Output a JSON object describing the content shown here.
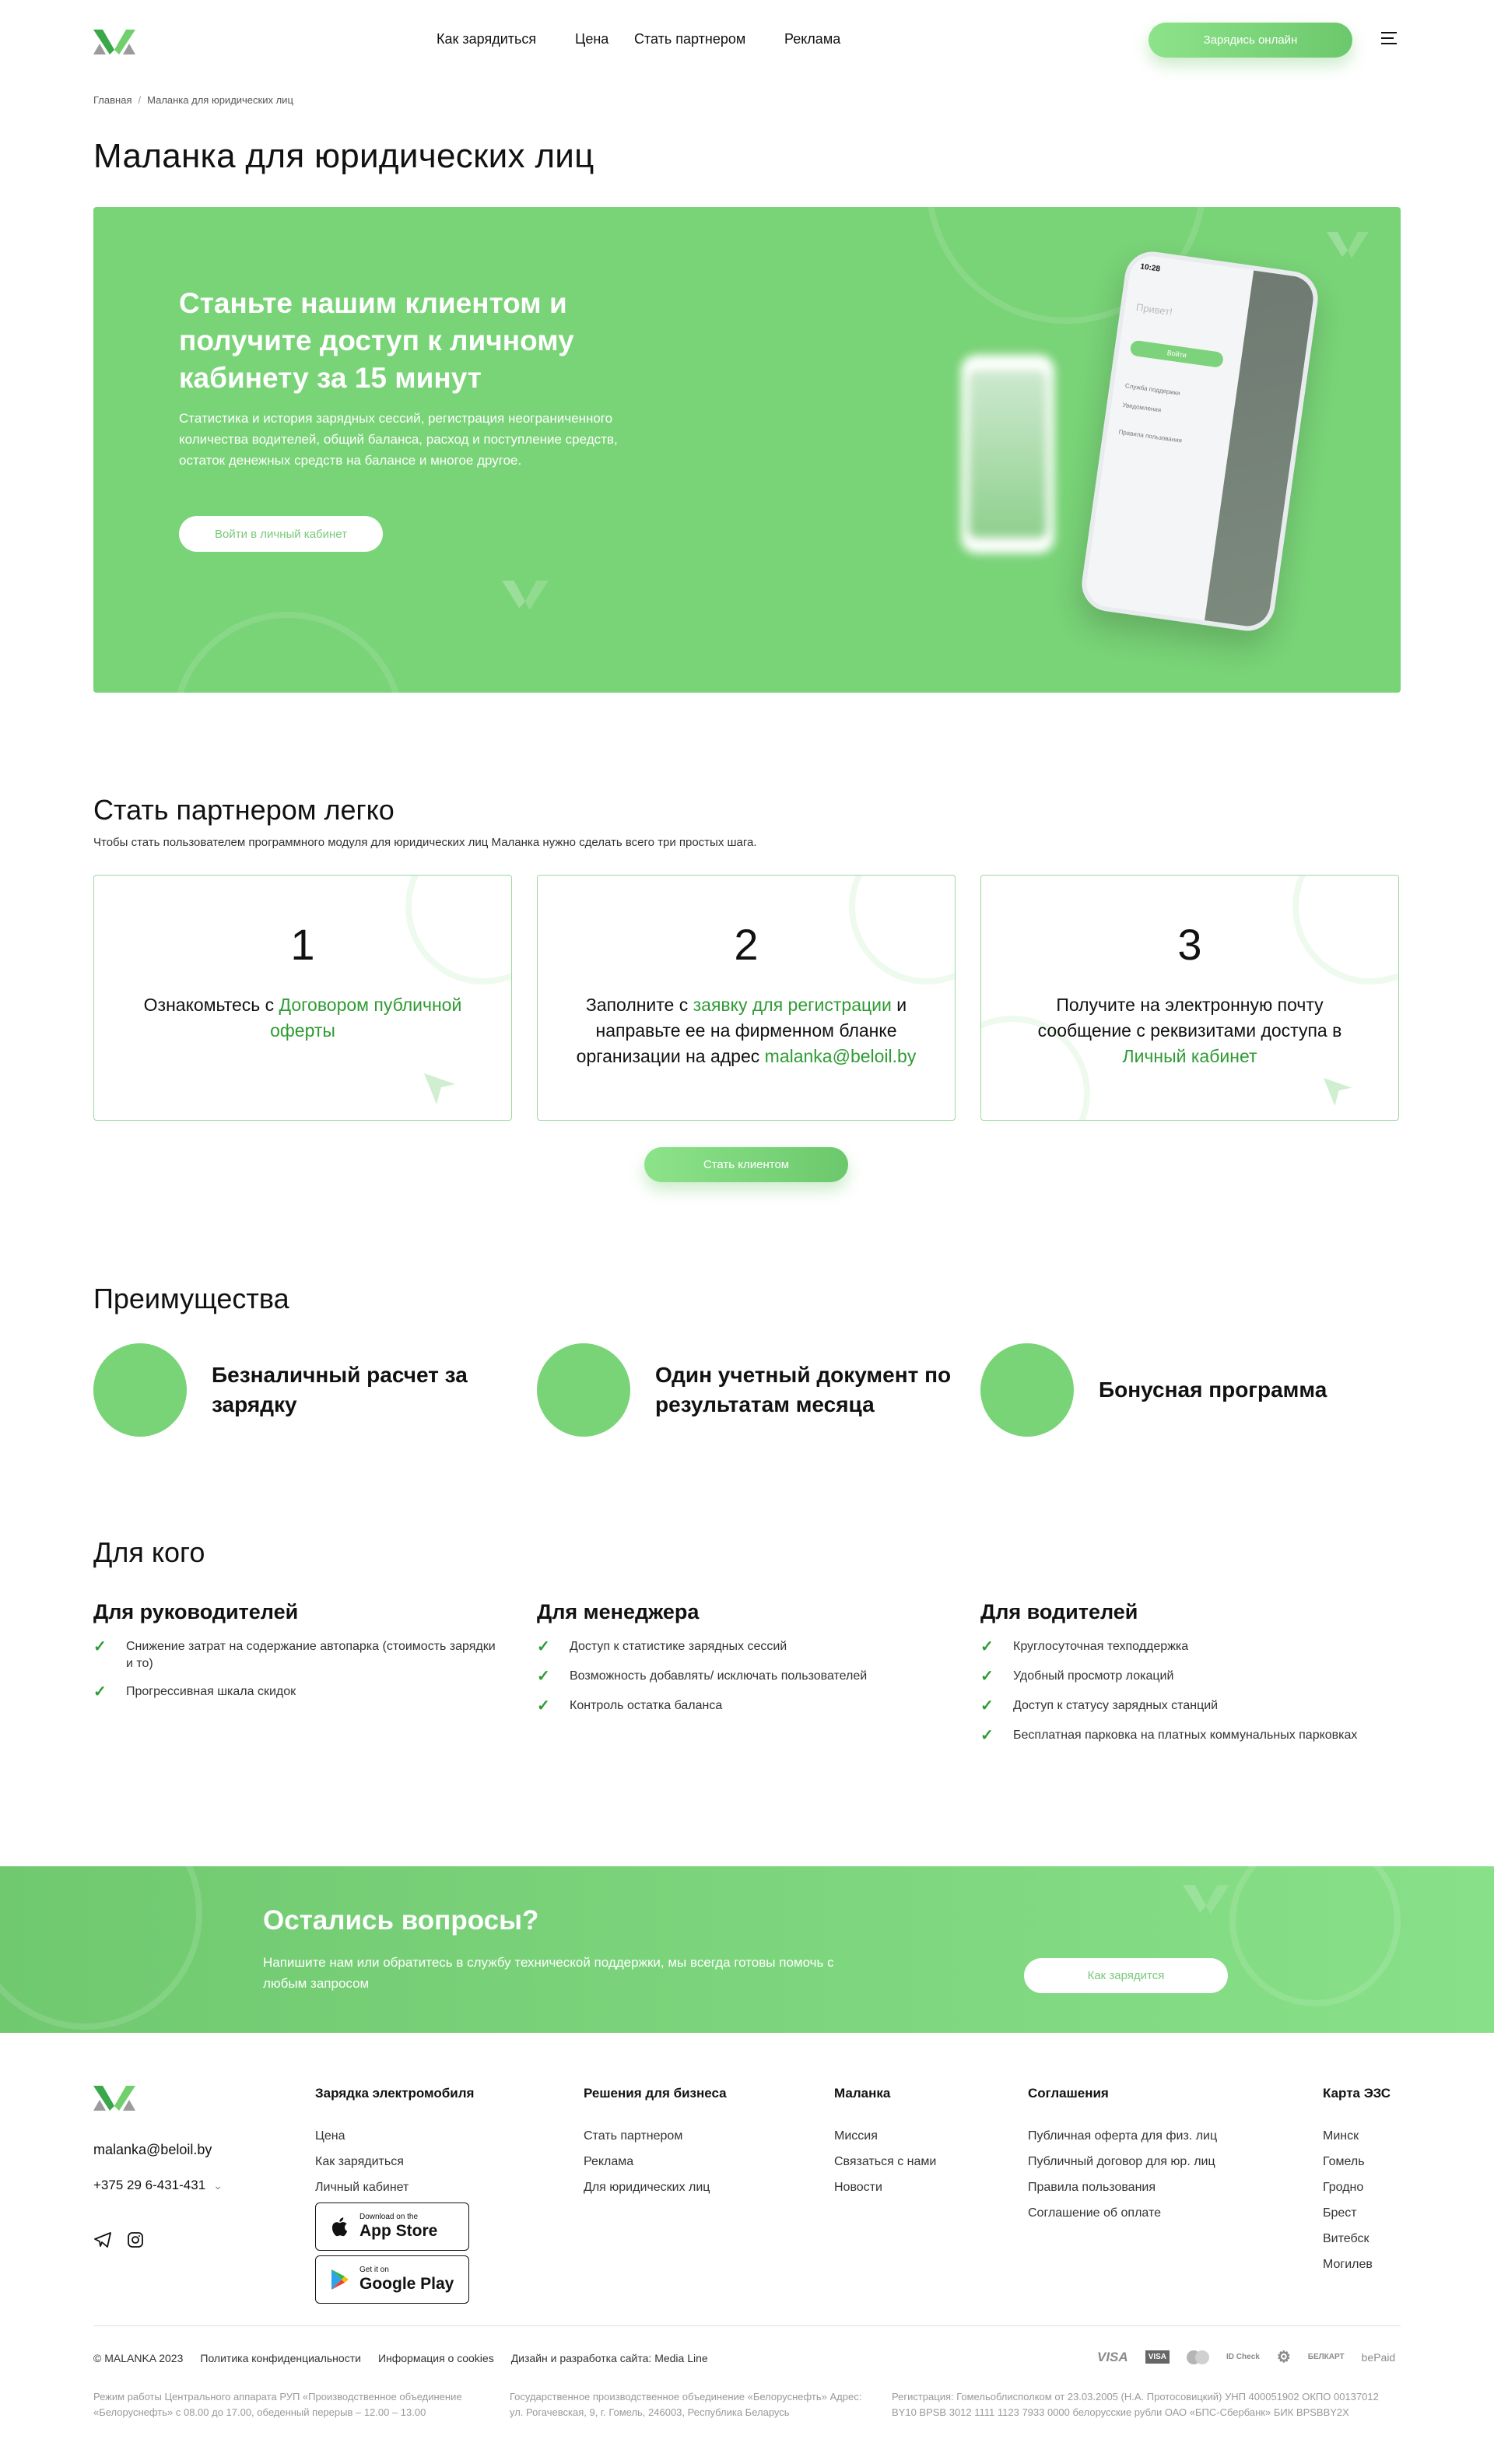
{
  "header": {
    "nav": [
      "Как зарядиться",
      "Цена",
      "Стать партнером",
      "Реклама"
    ],
    "cta": "Зарядись онлайн"
  },
  "breadcrumb": {
    "home": "Главная",
    "current": "Маланка для юридических лиц"
  },
  "page_title": "Маланка для юридических лиц",
  "hero": {
    "title": "Станьте нашим клиентом и получите доступ к личному кабинету за 15 минут",
    "text": "Статистика и история зарядных сессий, регистрация неограниченного количества водителей, общий баланса, расход и поступление средств, остаток денежных средств на балансе и многое другое.",
    "button": "Войти в личный кабинет",
    "phone": {
      "time": "10:28",
      "greeting": "Привет!",
      "login": "Войти",
      "menu": [
        "Служба поддержки",
        "Уведомления",
        "Правила пользования"
      ]
    }
  },
  "partner": {
    "title": "Стать партнером легко",
    "subtitle": "Чтобы стать пользователем программного модуля для юридических лиц Маланка нужно сделать всего три простых шага.",
    "steps": [
      {
        "num": "1",
        "pre": "Ознакомьтесь с ",
        "link": "Договором публичной оферты",
        "post": ""
      },
      {
        "num": "2",
        "pre": "Заполните с ",
        "link": "заявку для регистрации",
        "mid": " и направьте ее на фирменном бланке организации на адрес ",
        "email": "malanka@beloil.by"
      },
      {
        "num": "3",
        "pre": "Получите на электронную почту сообщение с реквизитами доступа в ",
        "link": "Личный кабинет"
      }
    ],
    "button": "Стать клиентом"
  },
  "advantages": {
    "title": "Преимущества",
    "items": [
      "Безналичный расчет за зарядку",
      "Один учетный документ по результатам месяца",
      "Бонусная программа"
    ]
  },
  "for_whom": {
    "title": "Для кого",
    "groups": [
      {
        "title": "Для руководителей",
        "items": [
          "Снижение затрат на содержание автопарка (стоимость зарядки и то)",
          "Прогрессивная шкала скидок"
        ]
      },
      {
        "title": "Для менеджера",
        "items": [
          "Доступ к статистике зарядных сессий",
          "Возможность добавлять/ исключать пользователей",
          "Контроль остатка баланса"
        ]
      },
      {
        "title": "Для водителей",
        "items": [
          "Круглосуточная техподдержка",
          "Удобный просмотр локаций",
          "Доступ к статусу зарядных станций",
          "Бесплатная парковка на платных коммунальных парковках"
        ]
      }
    ]
  },
  "cta": {
    "title": "Остались вопросы?",
    "text": "Напишите нам или обратитесь в службу технической поддержки, мы всегда готовы помочь с любым запросом",
    "button": "Как зарядится"
  },
  "footer": {
    "email": "malanka@beloil.by",
    "phone": "+375 29 6-431-431",
    "columns": [
      {
        "title": "Зарядка электромобиля",
        "links": [
          "Цена",
          "Как зарядиться",
          "Личный кабинет"
        ]
      },
      {
        "title": "Решения для бизнеса",
        "links": [
          "Стать партнером",
          "Реклама",
          "Для юридических лиц"
        ]
      },
      {
        "title": "Маланка",
        "links": [
          "Миссия",
          "Связаться с нами",
          "Новости"
        ]
      },
      {
        "title": "Соглашения",
        "links": [
          "Публичная оферта для физ. лиц",
          "Публичный договор для юр. лиц",
          "Правила пользования",
          "Соглашение об оплате"
        ]
      },
      {
        "title": "Карта ЭЗС",
        "links": [
          "Минск",
          "Гомель",
          "Гродно",
          "Брест",
          "Витебск",
          "Могилев"
        ]
      }
    ],
    "appstore": {
      "small": "Download on the",
      "big": "App Store"
    },
    "googleplay": {
      "small": "Get it on",
      "big": "Google Play"
    },
    "bottom": [
      "© MALANKA 2023",
      "Политика конфиденциальности",
      "Информация о cookies",
      "Дизайн и разработка сайта: Media Line"
    ],
    "payments": [
      "VISA",
      "VISA",
      "mastercard",
      "ID Check",
      "БЕЛКАРТ",
      "bePaid"
    ],
    "legal": [
      "Режим работы Центрального аппарата РУП «Производственное объединение «Белоруснефть» с 08.00 до 17.00, обеденный перерыв – 12.00 – 13.00",
      "Государственное производственное объединение «Белоруснефть» Адрес: ул. Рогачевская, 9, г. Гомель, 246003, Республика Беларусь",
      "Регистрация: Гомельоблисполком от 23.03.2005 (Н.А. Протосовицкий) УНП 400051902 ОКПО 00137012 BY10 BPSB 3012 1111 1123 7933 0000 белорусские рубли ОАО «БПС-Сбербанк» БИК BPSBBY2X"
    ]
  }
}
